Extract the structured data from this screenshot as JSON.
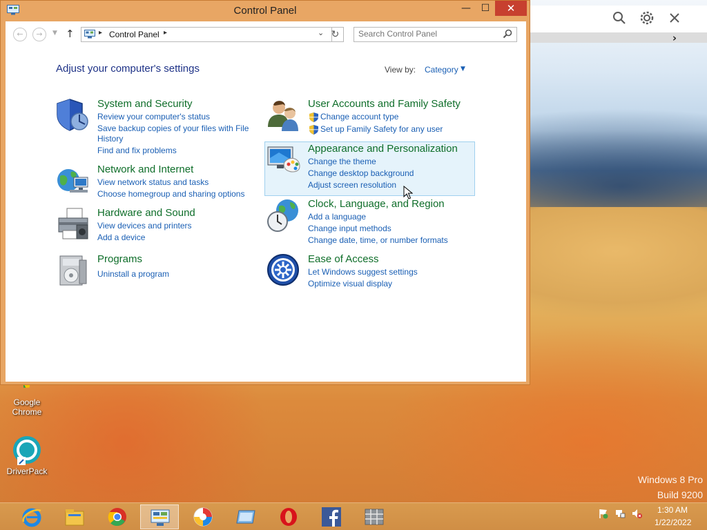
{
  "window": {
    "title": "Control Panel",
    "minimize_glyph": "—",
    "maximize_glyph": "☐",
    "close_glyph": "✕"
  },
  "nav": {
    "breadcrumb": "Control Panel",
    "search_placeholder": "Search Control Panel",
    "icons": [
      "back-arrow-icon",
      "forward-arrow-icon",
      "recent-locations-icon",
      "up-arrow-icon",
      "refresh-icon",
      "search-icon"
    ]
  },
  "header": {
    "title": "Adjust your computer's settings",
    "view_by_label": "View by:",
    "view_by_value": "Category"
  },
  "categories": [
    {
      "title": "System and Security",
      "links": [
        "Review your computer's status",
        "Save backup copies of your files with File",
        "History",
        "Find and fix problems"
      ],
      "icon": "shield-icon"
    },
    {
      "title": "Network and Internet",
      "links": [
        "View network status and tasks",
        "Choose homegroup and sharing options"
      ],
      "icon": "network-globe-icon"
    },
    {
      "title": "Hardware and Sound",
      "links": [
        "View devices and printers",
        "Add a device"
      ],
      "icon": "printer-icon"
    },
    {
      "title": "Programs",
      "links": [
        "Uninstall a program"
      ],
      "icon": "programs-icon"
    },
    {
      "title": "User Accounts and Family Safety",
      "links": [
        "Change account type",
        "Set up Family Safety for any user"
      ],
      "icon": "users-icon"
    },
    {
      "title": "Appearance and Personalization",
      "links": [
        "Change the theme",
        "Change desktop background",
        "Adjust screen resolution"
      ],
      "icon": "monitor-palette-icon"
    },
    {
      "title": "Clock, Language, and Region",
      "links": [
        "Add a language",
        "Change input methods",
        "Change date, time, or number formats"
      ],
      "icon": "clock-globe-icon"
    },
    {
      "title": "Ease of Access",
      "links": [
        "Let Windows suggest settings",
        "Optimize visual display"
      ],
      "icon": "ease-of-access-icon"
    }
  ],
  "desktop": {
    "icons": [
      {
        "label_line1": "Google",
        "label_line2": "Chrome"
      },
      {
        "label_line1": "DriverPack",
        "label_line2": ""
      }
    ],
    "watermark_line1": "Windows 8 Pro",
    "watermark_line2": "Build 9200"
  },
  "taskbar": {
    "items": [
      "internet-explorer-icon",
      "file-explorer-icon",
      "chrome-icon",
      "control-panel-icon",
      "browser-icon",
      "window-icon",
      "opera-icon",
      "facebook-icon",
      "app-grid-icon"
    ],
    "active_item": "control-panel-icon",
    "time": "1:30 AM",
    "date": "1/22/2022"
  },
  "colors": {
    "window_frame": "#e8a664",
    "close_button": "#c7402f",
    "category_title": "#0f6e2a",
    "link": "#1a5fb4",
    "page_title": "#1e3287",
    "taskbar": "#d08e45"
  }
}
